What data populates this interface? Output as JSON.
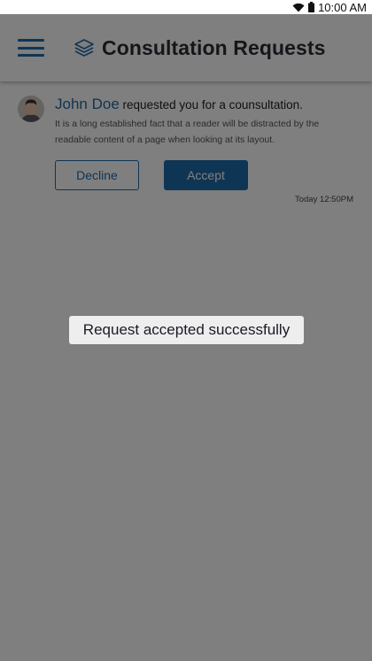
{
  "status_bar": {
    "time": "10:00 AM",
    "icons": [
      "wifi-icon",
      "battery-icon"
    ]
  },
  "header": {
    "menu_icon": "hamburger-menu-icon",
    "title_icon": "layers-icon",
    "title": "Consultation Requests"
  },
  "requests": [
    {
      "avatar": "user-avatar",
      "name": "John Doe",
      "action_text": "requested you for a counsultation.",
      "message": "It is a long established fact that a reader will be distracted by the readable content of a page when looking at its layout.",
      "decline_label": "Decline",
      "accept_label": "Accept",
      "timestamp": "Today 12:50PM"
    }
  ],
  "toast": {
    "message": "Request accepted successfully"
  },
  "colors": {
    "accent": "#1f6aa8",
    "overlay": "rgba(0,0,0,0.5)",
    "toast_bg": "#eeeeee"
  }
}
